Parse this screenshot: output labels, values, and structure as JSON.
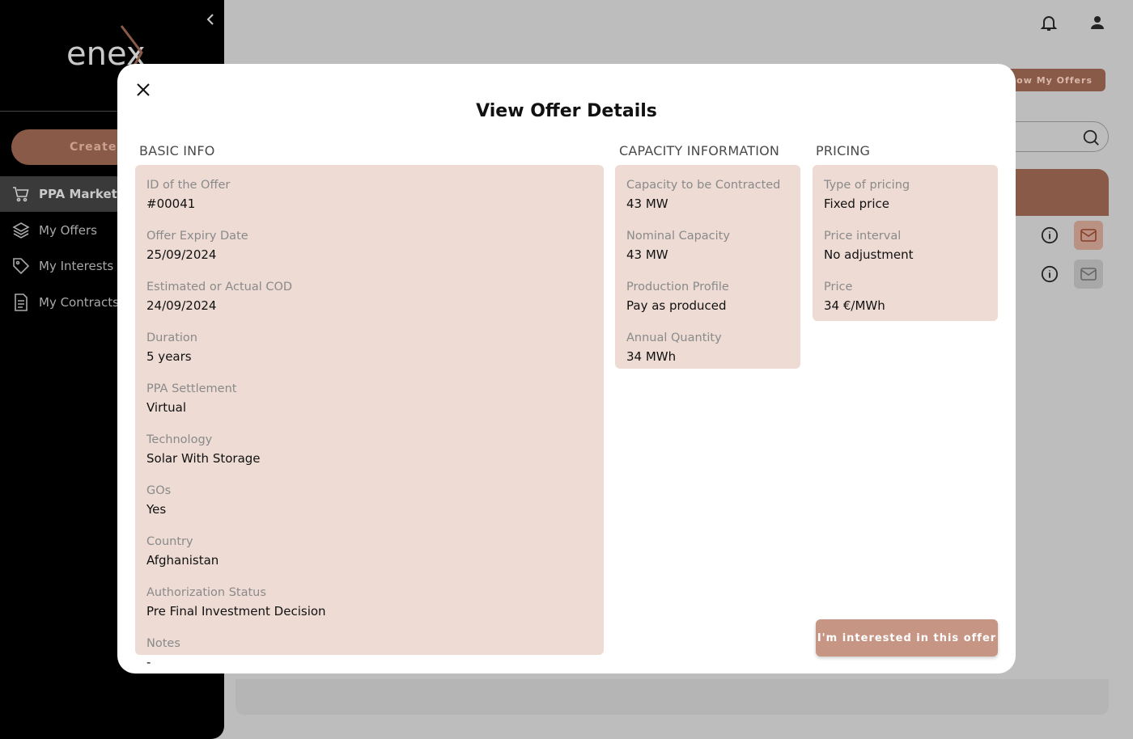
{
  "sidebar": {
    "logo_text": "enex",
    "create_label": "Create o",
    "items": [
      {
        "label": "PPA Market",
        "icon": "cart-icon",
        "active": true
      },
      {
        "label": "My Offers",
        "icon": "layers-icon",
        "active": false
      },
      {
        "label": "My Interests",
        "icon": "tag-icon",
        "active": false
      },
      {
        "label": "My Contracts",
        "icon": "document-icon",
        "active": false
      }
    ]
  },
  "header": {
    "show_offers_label": "Show My Offers"
  },
  "colors": {
    "accent": "#c79584",
    "accent_dark": "#8a5a49",
    "card_bg": "#eddbd4"
  },
  "modal": {
    "title": "View Offer Details",
    "close_icon": "close-icon",
    "basic_info": {
      "title": "BASIC INFO",
      "fields": [
        {
          "label": "ID of the Offer",
          "value": "#00041"
        },
        {
          "label": "Offer Expiry Date",
          "value": "25/09/2024"
        },
        {
          "label": "Estimated or Actual COD",
          "value": "24/09/2024"
        },
        {
          "label": "Duration",
          "value": "5 years"
        },
        {
          "label": "PPA Settlement",
          "value": "Virtual"
        },
        {
          "label": "Technology",
          "value": "Solar With Storage"
        },
        {
          "label": "GOs",
          "value": "Yes"
        },
        {
          "label": "Country",
          "value": "Afghanistan"
        },
        {
          "label": "Authorization Status",
          "value": "Pre Final Investment Decision"
        },
        {
          "label": "Notes",
          "value": "-"
        }
      ]
    },
    "capacity": {
      "title": "CAPACITY INFORMATION",
      "fields": [
        {
          "label": "Capacity to be Contracted",
          "value": "43 MW"
        },
        {
          "label": "Nominal Capacity",
          "value": "43 MW"
        },
        {
          "label": "Production Profile",
          "value": "Pay as produced"
        },
        {
          "label": "Annual Quantity",
          "value": "34 MWh"
        }
      ]
    },
    "pricing": {
      "title": "PRICING",
      "fields": [
        {
          "label": "Type of pricing",
          "value": "Fixed price"
        },
        {
          "label": "Price interval",
          "value": "No adjustment"
        },
        {
          "label": "Price",
          "value": "34 €/MWh"
        }
      ]
    },
    "interest_button": "I'm interested in this offer"
  }
}
